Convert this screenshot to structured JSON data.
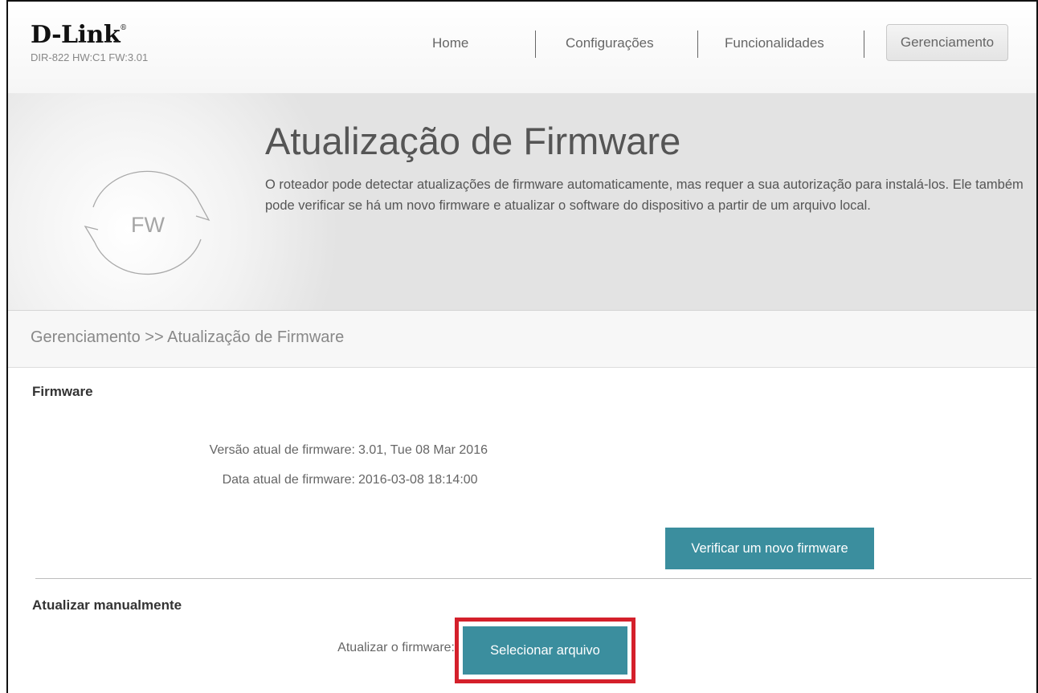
{
  "header": {
    "brand": "D-Link",
    "model_info": "DIR-822 HW:C1 FW:3.01",
    "nav": [
      "Home",
      "Configurações",
      "Funcionalidades",
      "Gerenciamento"
    ],
    "active_nav": "Gerenciamento"
  },
  "hero": {
    "title": "Atualização de Firmware",
    "icon_text": "FW",
    "icon": "refresh-arrows-icon",
    "description": "O roteador pode detectar atualizações de firmware automaticamente, mas requer a sua autorização para instalá-los. Ele também pode verificar se há um novo firmware e atualizar o software do dispositivo a partir de um arquivo local."
  },
  "breadcrumb": "Gerenciamento >> Atualização de Firmware",
  "firmware": {
    "section_title": "Firmware",
    "version_label": "Versão atual de firmware:",
    "version_value": "3.01, Tue 08 Mar 2016",
    "date_label": "Data atual de firmware:",
    "date_value": "2016-03-08 18:14:00",
    "check_button": "Verificar um novo firmware"
  },
  "manual": {
    "section_title": "Atualizar manualmente",
    "update_label": "Atualizar o firmware:",
    "select_button": "Selecionar arquivo"
  },
  "colors": {
    "button": "#3b8e9e",
    "highlight": "#d4202b"
  }
}
